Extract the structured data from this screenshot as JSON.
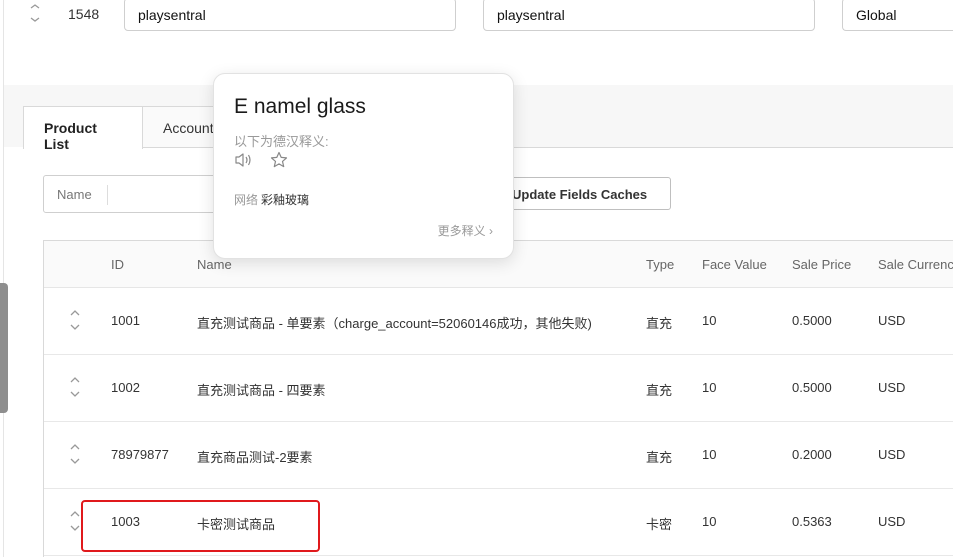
{
  "top_row": {
    "id": "1548",
    "field1": "playsentral",
    "field2": "playsentral",
    "field3": "Global"
  },
  "tabs": [
    "Product List",
    "Account"
  ],
  "filters": {
    "name_label": "Name",
    "update_button": "Update Fields Caches"
  },
  "table": {
    "columns": [
      "ID",
      "Name",
      "Type",
      "Face Value",
      "Sale Price",
      "Sale Currenc"
    ],
    "rows": [
      {
        "id": "1001",
        "name": "直充测试商品 - 单要素（charge_account=52060146成功，其他失败)",
        "type": "直充",
        "face_value": "10",
        "sale_price": "0.5000",
        "currency": "USD"
      },
      {
        "id": "1002",
        "name": "直充测试商品 - 四要素",
        "type": "直充",
        "face_value": "10",
        "sale_price": "0.5000",
        "currency": "USD"
      },
      {
        "id": "78979877",
        "name": "直充商品测试-2要素",
        "type": "直充",
        "face_value": "10",
        "sale_price": "0.2000",
        "currency": "USD"
      },
      {
        "id": "1003",
        "name": "卡密测试商品",
        "type": "卡密",
        "face_value": "10",
        "sale_price": "0.5363",
        "currency": "USD"
      }
    ]
  },
  "popup": {
    "word": "E namel glass",
    "subtitle": "以下为德汉释义:",
    "def_source": "网络",
    "def_text": "彩釉玻璃",
    "more": "更多释义 ›"
  },
  "colors": {
    "highlight": "#e0191c",
    "band": "#f7f7f7"
  }
}
